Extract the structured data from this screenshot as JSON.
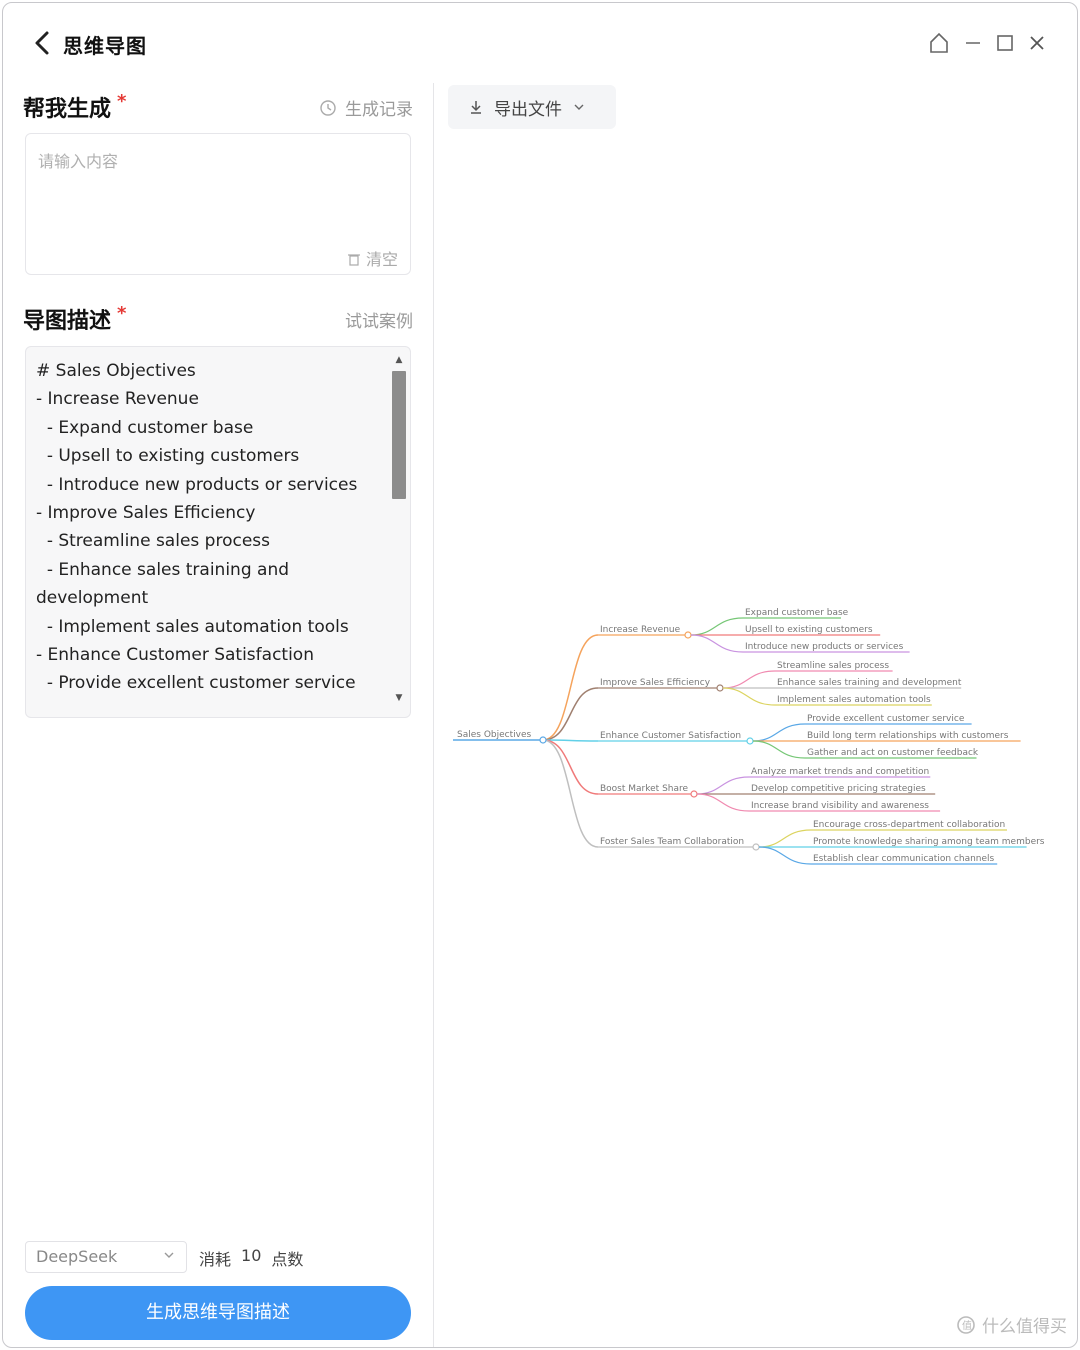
{
  "header": {
    "title": "思维导图"
  },
  "help_section": {
    "title": "帮我生成",
    "required_mark": "*",
    "history_label": "生成记录",
    "input_placeholder": "请输入内容",
    "clear_label": "清空"
  },
  "desc_section": {
    "title": "导图描述",
    "required_mark": "*",
    "example_label": "试试案例",
    "text": "# Sales Objectives\n- Increase Revenue\n  - Expand customer base\n  - Upsell to existing customers\n  - Introduce new products or services\n- Improve Sales Efficiency\n  - Streamline sales process\n  - Enhance sales training and development\n  - Implement sales automation tools\n- Enhance Customer Satisfaction\n  - Provide excellent customer service"
  },
  "footer": {
    "model": "DeepSeek",
    "cost_prefix": "消耗",
    "cost_value": "10",
    "cost_unit": "点数",
    "generate_label": "生成思维导图描述"
  },
  "toolbar": {
    "export_label": "导出文件"
  },
  "mindmap": {
    "root": "Sales Objectives",
    "branches": [
      {
        "label": "Increase Revenue",
        "color": "#f5a35c",
        "children": [
          {
            "label": "Expand customer base",
            "color": "#76c776"
          },
          {
            "label": "Upsell to existing customers",
            "color": "#f07a7a"
          },
          {
            "label": "Introduce new products or services",
            "color": "#c993e0"
          }
        ]
      },
      {
        "label": "Improve Sales Efficiency",
        "color": "#a08070",
        "children": [
          {
            "label": "Streamline sales process",
            "color": "#f08ab0"
          },
          {
            "label": "Enhance sales training and development",
            "color": "#bfbfbf"
          },
          {
            "label": "Implement sales automation tools",
            "color": "#dcd460"
          }
        ]
      },
      {
        "label": "Enhance Customer Satisfaction",
        "color": "#62d0e8",
        "children": [
          {
            "label": "Provide excellent customer service",
            "color": "#5aa8e6"
          },
          {
            "label": "Build long term relationships with customers",
            "color": "#f5a35c"
          },
          {
            "label": "Gather and act on customer feedback",
            "color": "#76c776"
          }
        ]
      },
      {
        "label": "Boost Market Share",
        "color": "#f07a7a",
        "children": [
          {
            "label": "Analyze market trends and competition",
            "color": "#c993e0"
          },
          {
            "label": "Develop competitive pricing strategies",
            "color": "#a08070"
          },
          {
            "label": "Increase brand visibility and awareness",
            "color": "#f08ab0"
          }
        ]
      },
      {
        "label": "Foster Sales Team Collaboration",
        "color": "#bfbfbf",
        "children": [
          {
            "label": "Encourage cross-department collaboration",
            "color": "#dcd460"
          },
          {
            "label": "Promote knowledge sharing among team members",
            "color": "#62d0e8"
          },
          {
            "label": "Establish clear communication channels",
            "color": "#5aa8e6"
          }
        ]
      }
    ]
  },
  "watermark": {
    "text": "什么值得买"
  },
  "colors": {
    "accent": "#3e96f4",
    "required": "#e53935"
  }
}
